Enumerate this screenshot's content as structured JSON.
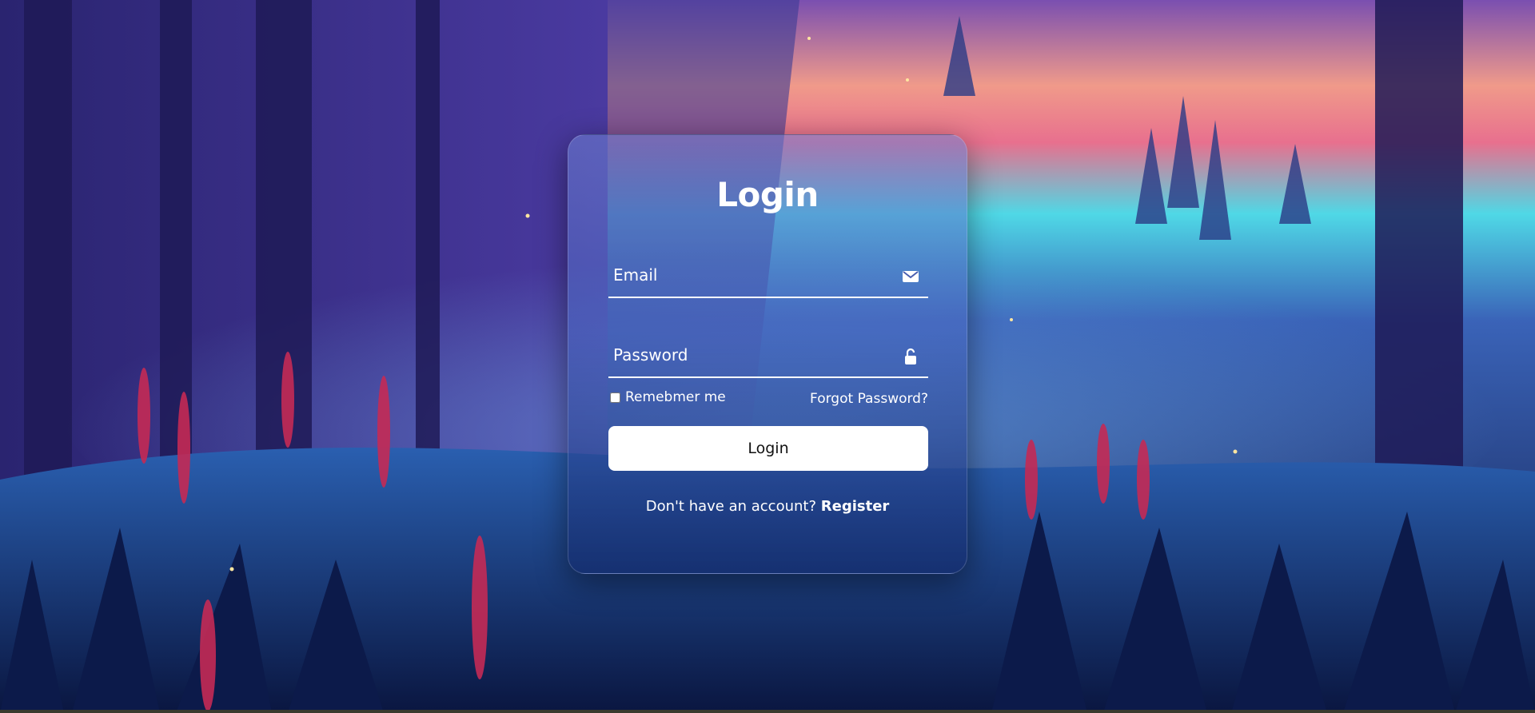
{
  "login": {
    "title": "Login",
    "email": {
      "placeholder": "Email",
      "icon": "envelope-icon"
    },
    "password": {
      "placeholder": "Password",
      "icon": "lock-icon"
    },
    "remember_label": "Remebmer me",
    "forgot_label": "Forgot Password?",
    "submit_label": "Login",
    "register_prompt": "Don't have an account?",
    "register_label": "Register"
  },
  "colors": {
    "button_bg": "#ffffff",
    "text": "#ffffff"
  }
}
